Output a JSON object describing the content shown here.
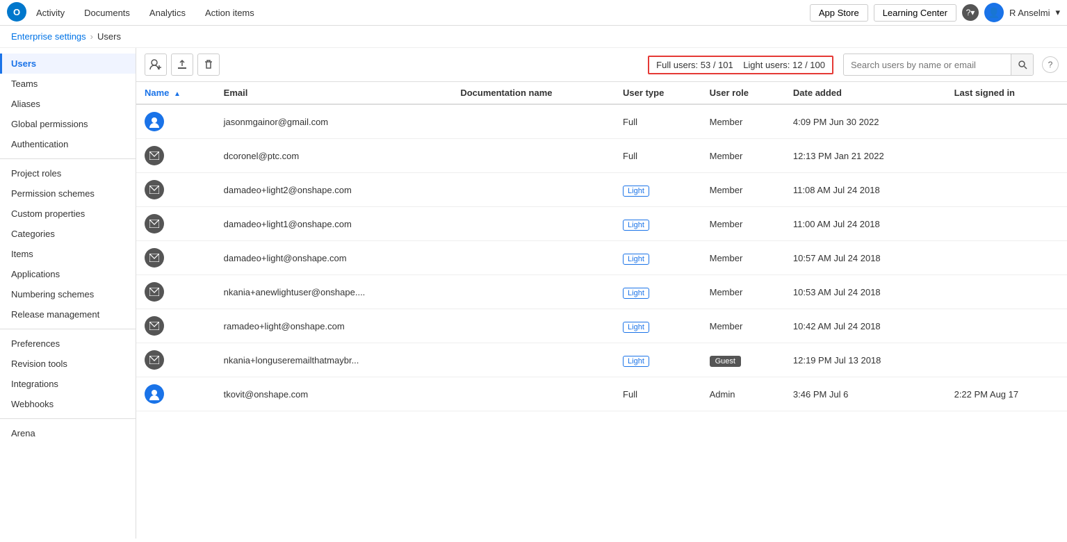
{
  "topNav": {
    "links": [
      {
        "id": "activity",
        "label": "Activity"
      },
      {
        "id": "documents",
        "label": "Documents"
      },
      {
        "id": "analytics",
        "label": "Analytics"
      },
      {
        "id": "action-items",
        "label": "Action items"
      }
    ],
    "appStore": "App Store",
    "learningCenter": "Learning Center",
    "helpIcon": "?",
    "userAvatar": "👤",
    "userName": "R Anselmi"
  },
  "breadcrumb": {
    "parent": "Enterprise settings",
    "separator": "›",
    "current": "Users"
  },
  "sidebar": {
    "items": [
      {
        "id": "users",
        "label": "Users",
        "active": true
      },
      {
        "id": "teams",
        "label": "Teams"
      },
      {
        "id": "aliases",
        "label": "Aliases"
      },
      {
        "id": "global-permissions",
        "label": "Global permissions"
      },
      {
        "id": "authentication",
        "label": "Authentication"
      },
      {
        "id": "project-roles",
        "label": "Project roles"
      },
      {
        "id": "permission-schemes",
        "label": "Permission schemes"
      },
      {
        "id": "custom-properties",
        "label": "Custom properties"
      },
      {
        "id": "categories",
        "label": "Categories"
      },
      {
        "id": "items",
        "label": "Items"
      },
      {
        "id": "applications",
        "label": "Applications"
      },
      {
        "id": "numbering-schemes",
        "label": "Numbering schemes"
      },
      {
        "id": "release-management",
        "label": "Release management"
      },
      {
        "id": "preferences",
        "label": "Preferences"
      },
      {
        "id": "revision-tools",
        "label": "Revision tools"
      },
      {
        "id": "integrations",
        "label": "Integrations"
      },
      {
        "id": "webhooks",
        "label": "Webhooks"
      },
      {
        "id": "arena",
        "label": "Arena"
      }
    ]
  },
  "toolbar": {
    "addUserBtn": "👤+",
    "uploadBtn": "⬆",
    "deleteBtn": "🗑",
    "fullUsersLabel": "Full users: 53 / 101",
    "lightUsersLabel": "Light users: 12 / 100",
    "searchPlaceholder": "Search users by name or email",
    "helpCircle": "?"
  },
  "table": {
    "columns": [
      {
        "id": "name",
        "label": "Name",
        "sorted": true,
        "sortDir": "▲"
      },
      {
        "id": "email",
        "label": "Email"
      },
      {
        "id": "doc-name",
        "label": "Documentation name"
      },
      {
        "id": "user-type",
        "label": "User type"
      },
      {
        "id": "user-role",
        "label": "User role"
      },
      {
        "id": "date-added",
        "label": "Date added"
      },
      {
        "id": "last-signed",
        "label": "Last signed in"
      }
    ],
    "rows": [
      {
        "avatarType": "circle",
        "name": "",
        "email": "jasonmgainor@gmail.com",
        "docName": "",
        "userType": "Full",
        "userTypeBadge": false,
        "userRole": "Member",
        "userRoleBadge": false,
        "dateAdded": "4:09 PM Jun 30 2022",
        "lastSignedIn": ""
      },
      {
        "avatarType": "email",
        "name": "",
        "email": "dcoronel@ptc.com",
        "docName": "",
        "userType": "Full",
        "userTypeBadge": false,
        "userRole": "Member",
        "userRoleBadge": false,
        "dateAdded": "12:13 PM Jan 21 2022",
        "lastSignedIn": ""
      },
      {
        "avatarType": "email",
        "name": "",
        "email": "damadeo+light2@onshape.com",
        "docName": "",
        "userType": "Light",
        "userTypeBadge": true,
        "userRole": "Member",
        "userRoleBadge": false,
        "dateAdded": "11:08 AM Jul 24 2018",
        "lastSignedIn": ""
      },
      {
        "avatarType": "email",
        "name": "",
        "email": "damadeo+light1@onshape.com",
        "docName": "",
        "userType": "Light",
        "userTypeBadge": true,
        "userRole": "Member",
        "userRoleBadge": false,
        "dateAdded": "11:00 AM Jul 24 2018",
        "lastSignedIn": ""
      },
      {
        "avatarType": "email",
        "name": "",
        "email": "damadeo+light@onshape.com",
        "docName": "",
        "userType": "Light",
        "userTypeBadge": true,
        "userRole": "Member",
        "userRoleBadge": false,
        "dateAdded": "10:57 AM Jul 24 2018",
        "lastSignedIn": ""
      },
      {
        "avatarType": "email",
        "name": "",
        "email": "nkania+anewlightuser@onshape....",
        "docName": "",
        "userType": "Light",
        "userTypeBadge": true,
        "userRole": "Member",
        "userRoleBadge": false,
        "dateAdded": "10:53 AM Jul 24 2018",
        "lastSignedIn": ""
      },
      {
        "avatarType": "email",
        "name": "",
        "email": "ramadeo+light@onshape.com",
        "docName": "",
        "userType": "Light",
        "userTypeBadge": true,
        "userRole": "Member",
        "userRoleBadge": false,
        "dateAdded": "10:42 AM Jul 24 2018",
        "lastSignedIn": ""
      },
      {
        "avatarType": "email",
        "name": "",
        "email": "nkania+longuseremail​thatmaybr...",
        "docName": "",
        "userType": "Light",
        "userTypeBadge": true,
        "userRole": "Guest",
        "userRoleBadge": true,
        "dateAdded": "12:19 PM Jul 13 2018",
        "lastSignedIn": ""
      },
      {
        "avatarType": "circle",
        "name": "",
        "email": "tkovit@onshape.com",
        "docName": "",
        "userType": "Full",
        "userTypeBadge": false,
        "userRole": "Admin",
        "userRoleBadge": false,
        "dateAdded": "3:46 PM Jul 6",
        "lastSignedIn": "2:22 PM Aug 17"
      }
    ]
  }
}
